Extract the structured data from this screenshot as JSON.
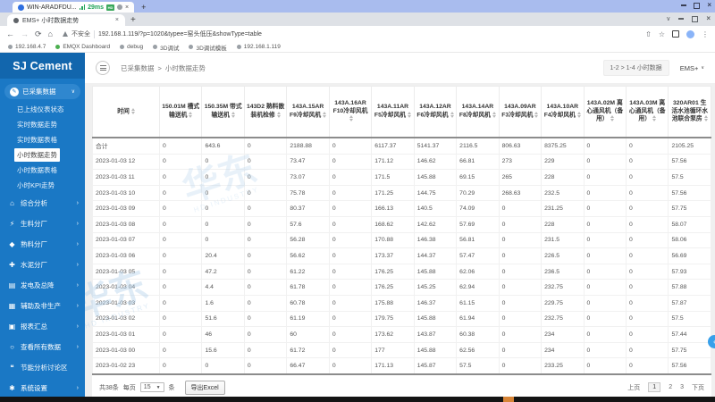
{
  "remote_bar": {
    "title": "WIN-ARADFDU...",
    "latency": "29ms"
  },
  "browser": {
    "tab_title": "EMS+ 小时数据走势",
    "security_label": "不安全",
    "url": "192.168.1.119/?p=1020&typee=窑头低压&showType=table",
    "bookmarks": [
      "192.168.4.7",
      "EMQX Dashboard",
      "debug",
      "3D调试",
      "3D调试模板",
      "192.168.1.119"
    ]
  },
  "sidebar": {
    "brand": "SJ Cement",
    "group_label": "已采集数据",
    "submenu": [
      "已上线仪表状态",
      "实时数据走势",
      "实时数据表格",
      "小时数据走势",
      "小时数据表格",
      "小时KPI走势"
    ],
    "active_submenu": "小时数据走势",
    "items": [
      {
        "label": "综合分析",
        "icon": "home-icon",
        "chevron": true
      },
      {
        "label": "生料分厂",
        "icon": "bolt-icon",
        "chevron": true
      },
      {
        "label": "熟料分厂",
        "icon": "drop-icon",
        "chevron": true
      },
      {
        "label": "水泥分厂",
        "icon": "faucet-icon",
        "chevron": true
      },
      {
        "label": "发电及总降",
        "icon": "power-icon",
        "chevron": true
      },
      {
        "label": "辅助及非生产",
        "icon": "factory-icon",
        "chevron": true
      },
      {
        "label": "报表汇总",
        "icon": "report-icon",
        "chevron": true
      },
      {
        "label": "查看所有数据",
        "icon": "search-icon",
        "chevron": true
      },
      {
        "label": "节能分析讨论区",
        "icon": "comment-icon",
        "chevron": false
      },
      {
        "label": "系统设置",
        "icon": "gear-icon",
        "chevron": true
      }
    ]
  },
  "header": {
    "breadcrumb_parent": "已采集数据",
    "breadcrumb_sep": ">",
    "breadcrumb_current": "小时数据走势",
    "range_label": "1-2 > 1-4 小时数据",
    "account_label": "EMS+"
  },
  "table": {
    "columns": [
      "时间",
      "150.01M 槽式输送机",
      "150.35M 带式输送机",
      "143D2 熟料散装机检修",
      "143A.15AR F9冷却风机",
      "143A.16AR F10冷却风机",
      "143A.11AR F5冷却风机",
      "143A.12AR F6冷却风机",
      "143A.14AR F8冷却风机",
      "143A.09AR F3冷却风机",
      "143A.10AR F4冷却风机",
      "143A.02M 离心通风机（备用）",
      "143A.03M 离心通风机（备用）",
      "320AR01 生活水池循环水池联合泵房"
    ],
    "rows": [
      [
        "合计",
        "0",
        "643.6",
        "0",
        "2188.88",
        "0",
        "6117.37",
        "5141.37",
        "2116.5",
        "806.63",
        "8375.25",
        "0",
        "0",
        "2105.25"
      ],
      [
        "2023-01-03 12",
        "0",
        "0",
        "0",
        "73.47",
        "0",
        "171.12",
        "146.62",
        "66.81",
        "273",
        "229",
        "0",
        "0",
        "57.56"
      ],
      [
        "2023-01-03 11",
        "0",
        "0",
        "0",
        "73.07",
        "0",
        "171.5",
        "145.88",
        "69.15",
        "265",
        "228",
        "0",
        "0",
        "57.5"
      ],
      [
        "2023-01-03 10",
        "0",
        "0",
        "0",
        "75.78",
        "0",
        "171.25",
        "144.75",
        "70.29",
        "268.63",
        "232.5",
        "0",
        "0",
        "57.56"
      ],
      [
        "2023-01-03 09",
        "0",
        "0",
        "0",
        "80.37",
        "0",
        "166.13",
        "140.5",
        "74.09",
        "0",
        "231.25",
        "0",
        "0",
        "57.75"
      ],
      [
        "2023-01-03 08",
        "0",
        "0",
        "0",
        "57.6",
        "0",
        "168.62",
        "142.62",
        "57.69",
        "0",
        "228",
        "0",
        "0",
        "58.07"
      ],
      [
        "2023-01-03 07",
        "0",
        "0",
        "0",
        "56.28",
        "0",
        "170.88",
        "146.38",
        "56.81",
        "0",
        "231.5",
        "0",
        "0",
        "58.06"
      ],
      [
        "2023-01-03 06",
        "0",
        "20.4",
        "0",
        "56.62",
        "0",
        "173.37",
        "144.37",
        "57.47",
        "0",
        "226.5",
        "0",
        "0",
        "56.69"
      ],
      [
        "2023-01-03 05",
        "0",
        "47.2",
        "0",
        "61.22",
        "0",
        "176.25",
        "145.88",
        "62.06",
        "0",
        "236.5",
        "0",
        "0",
        "57.93"
      ],
      [
        "2023-01-03 04",
        "0",
        "4.4",
        "0",
        "61.78",
        "0",
        "176.25",
        "145.25",
        "62.94",
        "0",
        "232.75",
        "0",
        "0",
        "57.88"
      ],
      [
        "2023-01-03 03",
        "0",
        "1.6",
        "0",
        "60.78",
        "0",
        "175.88",
        "146.37",
        "61.15",
        "0",
        "229.75",
        "0",
        "0",
        "57.87"
      ],
      [
        "2023-01-03 02",
        "0",
        "51.6",
        "0",
        "61.19",
        "0",
        "179.75",
        "145.88",
        "61.94",
        "0",
        "232.75",
        "0",
        "0",
        "57.5"
      ],
      [
        "2023-01-03 01",
        "0",
        "46",
        "0",
        "60",
        "0",
        "173.62",
        "143.87",
        "60.38",
        "0",
        "234",
        "0",
        "0",
        "57.44"
      ],
      [
        "2023-01-03 00",
        "0",
        "15.6",
        "0",
        "61.72",
        "0",
        "177",
        "145.88",
        "62.56",
        "0",
        "234",
        "0",
        "0",
        "57.75"
      ],
      [
        "2023-01-02 23",
        "0",
        "0",
        "0",
        "66.47",
        "0",
        "171.13",
        "145.87",
        "57.5",
        "0",
        "233.25",
        "0",
        "0",
        "57.56"
      ]
    ]
  },
  "footer": {
    "total_text": "共38条",
    "per_page_label": "每页",
    "page_size": "15",
    "unit_label": "条",
    "export_label": "导出Excel",
    "prev_label": "上页",
    "pages": [
      "1",
      "2",
      "3"
    ],
    "active_page": "1",
    "next_label": "下页"
  },
  "watermark": {
    "cn": "华东",
    "en": "HD INDUSTRY"
  },
  "colors": {
    "sidebar_blue": "#1a78c5",
    "brand_blue": "#1266ad",
    "latency_green": "#23a55a",
    "taskbar_accent": "#d78436",
    "float_button_blue": "#38a0ea"
  }
}
